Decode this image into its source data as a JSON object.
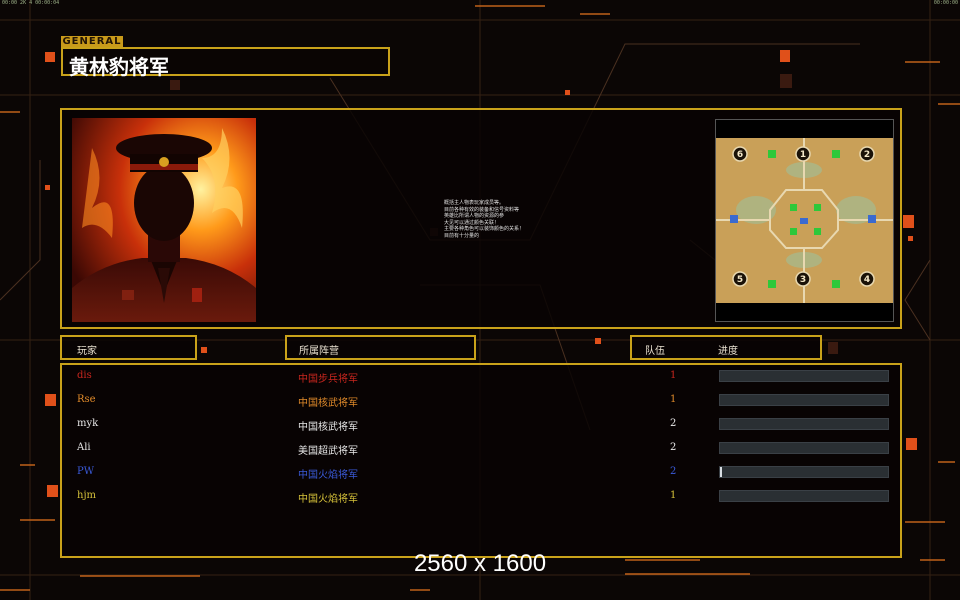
{
  "status_left": "00:00 2K 4  00:00:04",
  "status_right": "00:00:00",
  "general_tag": "GENERAL",
  "general_name": "黄林豹将军",
  "briefing_lines": [
    "概括主人物表玩家成员等。",
    "目前各种有效的装备和信号资料等",
    "英雄比所谓人物的资源的参",
    "大见可以通过颜色关联！",
    "主要各种角色可以装饰颜色的关系！",
    "目前有十分量的"
  ],
  "columns": {
    "player": "玩家",
    "faction": "所属阵营",
    "team": "队伍",
    "progress": "进度"
  },
  "players": [
    {
      "name": "dis",
      "faction": "中国步兵将军",
      "team": "1",
      "color": "#c8261e",
      "faction_color": "#c8261e",
      "progress": 0
    },
    {
      "name": "Rse",
      "faction": "中国核武将军",
      "team": "1",
      "color": "#e08a2a",
      "faction_color": "#e08a2a",
      "progress": 0
    },
    {
      "name": "myk",
      "faction": "中国核武将军",
      "team": "2",
      "color": "#e8e8e8",
      "faction_color": "#e8e8e8",
      "progress": 0
    },
    {
      "name": "Ali",
      "faction": "美国超武将军",
      "team": "2",
      "color": "#e8e8e8",
      "faction_color": "#e8e8e8",
      "progress": 0
    },
    {
      "name": "PW",
      "faction": "中国火焰将军",
      "team": "2",
      "color": "#3a5ad8",
      "faction_color": "#3a5ad8",
      "progress": 0.01
    },
    {
      "name": "hjm",
      "faction": "中国火焰将军",
      "team": "1",
      "color": "#d6c23a",
      "faction_color": "#d6c23a",
      "progress": 0
    }
  ],
  "map_slots": [
    "6",
    "1",
    "2",
    "5",
    "3",
    "4"
  ],
  "resolution_label": "2560 x 1600",
  "accent_color": "#c9a21a"
}
